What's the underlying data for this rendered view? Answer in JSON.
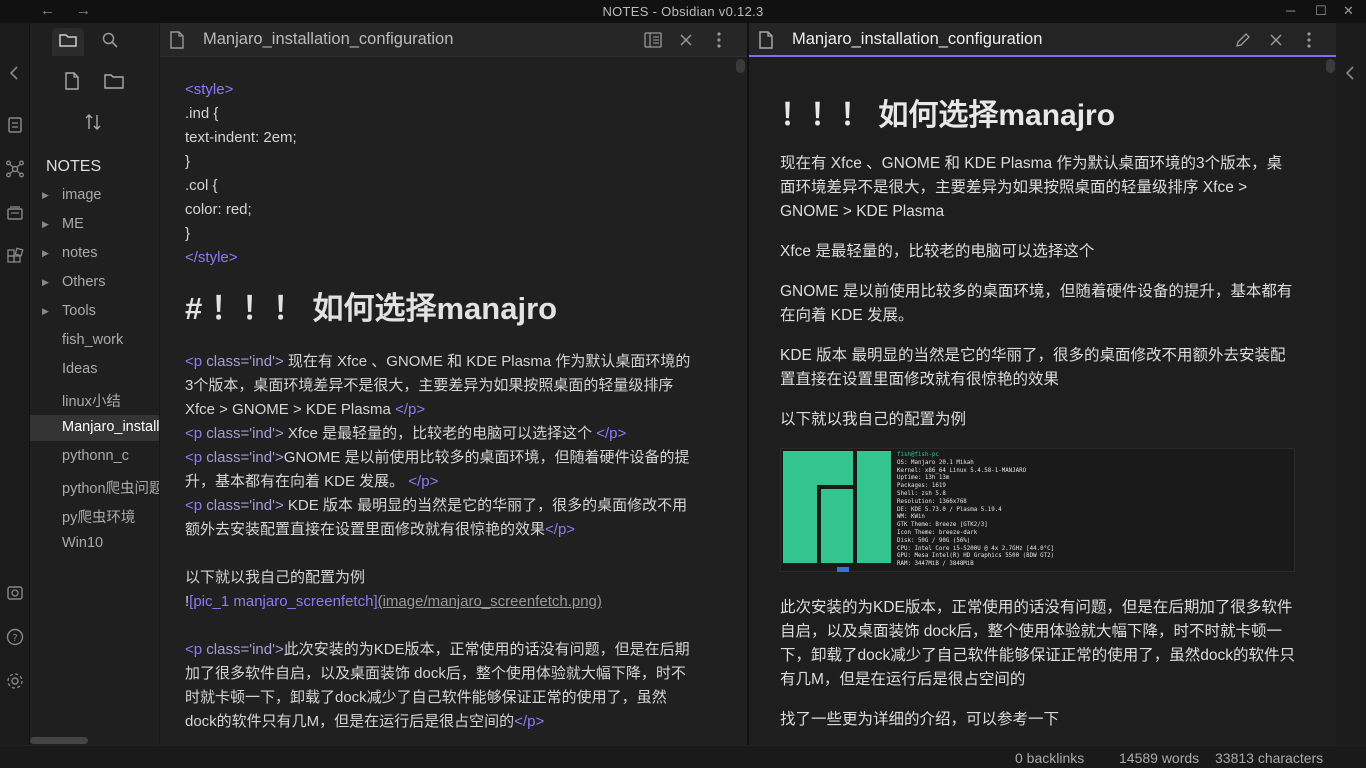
{
  "window": {
    "title": "NOTES - Obsidian v0.12.3"
  },
  "file_explorer": {
    "vault_name": "NOTES",
    "items": [
      {
        "label": "image",
        "folder": true
      },
      {
        "label": "ME",
        "folder": true
      },
      {
        "label": "notes",
        "folder": true
      },
      {
        "label": "Others",
        "folder": true
      },
      {
        "label": "Tools",
        "folder": true
      },
      {
        "label": "fish_work",
        "folder": false
      },
      {
        "label": "Ideas",
        "folder": false
      },
      {
        "label": "linux小结",
        "folder": false
      },
      {
        "label": "Manjaro_installation_configuration",
        "folder": false,
        "active": true
      },
      {
        "label": "pythonn_c",
        "folder": false
      },
      {
        "label": "python爬虫问题",
        "folder": false
      },
      {
        "label": "py爬虫环境",
        "folder": false
      },
      {
        "label": "Win10",
        "folder": false
      }
    ]
  },
  "left_pane": {
    "title": "Manjaro_installation_configuration",
    "code": {
      "style_open": "<style>",
      "l1": ".ind {",
      "l2": "text-indent: 2em;",
      "l3": "}",
      "l4": ".col {",
      "l5": "color: red;",
      "l6": "}",
      "style_close": "</style>",
      "h1_hash": "#",
      "h1_text": "！！！ 如何选择manajro",
      "p_open": "<p",
      "p_attr": " class='ind'>",
      "p_close": "</p>",
      "para1": " 现在有 Xfce 、GNOME 和 KDE Plasma 作为默认桌面环境的3个版本，桌面环境差异不是很大，主要差异为如果按照桌面的轻量级排序 Xfce > GNOME > KDE Plasma ",
      "para2": " Xfce 是最轻量的，比较老的电脑可以选择这个 ",
      "para3": "GNOME 是以前使用比较多的桌面环境，但随着硬件设备的提升，基本都有在向着 KDE 发展。 ",
      "para4": " KDE 版本 最明显的当然是它的华丽了，很多的桌面修改不用额外去安装配置直接在设置里面修改就有很惊艳的效果",
      "example": "以下就以我自己的配置为例",
      "img_bang": "!",
      "img_alt": "[pic_1 manjaro_screenfetch]",
      "img_url": "(image/manjaro_screenfetch.png)",
      "para5": "此次安装的为KDE版本，正常使用的话没有问题，但是在后期加了很多软件自启，以及桌面装饰 dock后，整个使用体验就大幅下降，时不时就卡顿一下，卸载了dock减少了自己软件能够保证正常的使用了，虽然dock的软件只有几M，但是在运行后是很占空间的"
    }
  },
  "right_pane": {
    "title": "Manjaro_installation_configuration",
    "h1": "！！！ 如何选择manajro",
    "paragraphs": [
      "现在有 Xfce 、GNOME 和 KDE Plasma 作为默认桌面环境的3个版本，桌面环境差异不是很大，主要差异为如果按照桌面的轻量级排序 Xfce > GNOME > KDE Plasma",
      "Xfce 是最轻量的，比较老的电脑可以选择这个",
      "GNOME 是以前使用比较多的桌面环境，但随着硬件设备的提升，基本都有在向着 KDE 发展。",
      "KDE 版本 最明显的当然是它的华丽了，很多的桌面修改不用额外去安装配置直接在设置里面修改就有很惊艳的效果",
      "以下就以我自己的配置为例"
    ],
    "screenfetch": {
      "lines": [
        "fish@fish-pc",
        "OS: Manjaro 20.1 Mikah",
        "Kernel: x86_64 Linux 5.4.58-1-MANJARO",
        "Uptime: 13h 13m",
        "Packages: 1619",
        "Shell: zsh 5.8",
        "Resolution: 1366x768",
        "DE: KDE 5.73.0 / Plasma 5.19.4",
        "WM: KWin",
        "GTK Theme: Breeze [GTK2/3]",
        "Icon Theme: breeze-dark",
        "Disk: 50G / 90G (56%)",
        "CPU: Intel Core i5-5200U @ 4x 2.7GHz [44.0°C]",
        "GPU: Mesa Intel(R) HD Graphics 5500 (BDW GT2)",
        "RAM: 3447MiB / 3848MiB"
      ]
    },
    "paragraphs2": [
      "此次安装的为KDE版本，正常使用的话没有问题，但是在后期加了很多软件自启，以及桌面装饰 dock后，整个使用体验就大幅下降，时不时就卡顿一下，卸载了dock减少了自己软件能够保证正常的使用了，虽然dock的软件只有几M，但是在运行后是很占空间的",
      "找了一些更为详细的介绍，可以参考一下"
    ]
  },
  "status": {
    "backlinks": "0 backlinks",
    "words": "14589 words",
    "characters": "33813 characters"
  },
  "colors": {
    "accent": "#7f6df2",
    "manjaro_green": "#35bf5c"
  }
}
